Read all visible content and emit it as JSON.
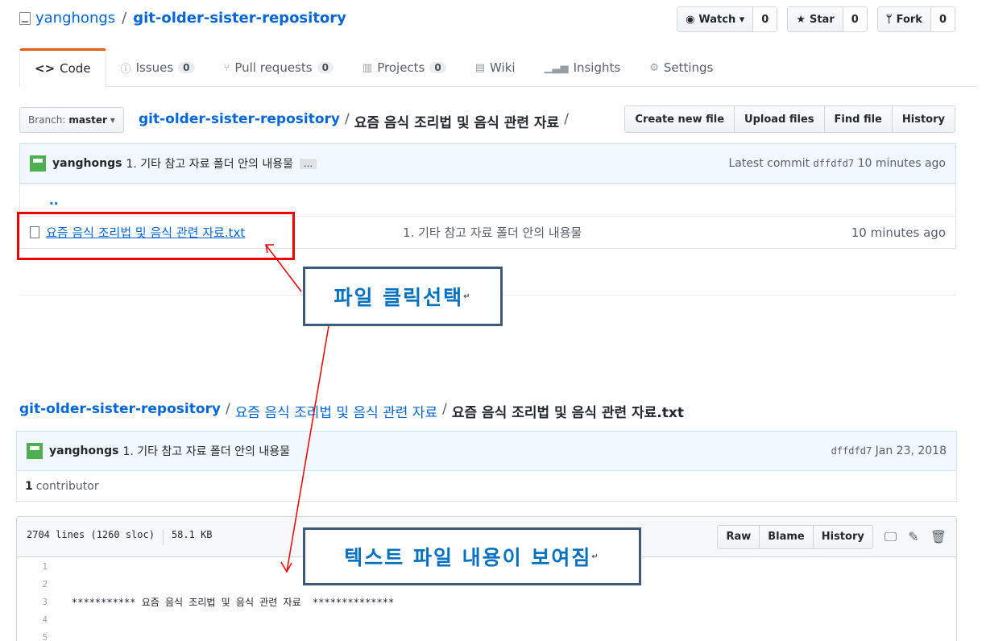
{
  "repo": {
    "owner": "yanghongs",
    "separator": "/",
    "name": "git-older-sister-repository"
  },
  "pagehead": {
    "watch_label": "Watch ▾",
    "watch_count": "0",
    "star_label": "Star",
    "star_count": "0",
    "fork_label": "Fork",
    "fork_count": "0"
  },
  "tabs": [
    {
      "label": "Code",
      "icon": "code-icon"
    },
    {
      "label": "Issues",
      "count": "0",
      "icon": "issue-icon"
    },
    {
      "label": "Pull requests",
      "count": "0",
      "icon": "pr-icon"
    },
    {
      "label": "Projects",
      "count": "0",
      "icon": "project-icon"
    },
    {
      "label": "Wiki",
      "icon": "wiki-icon"
    },
    {
      "label": "Insights",
      "icon": "graph-icon"
    },
    {
      "label": "Settings",
      "icon": "gear-icon"
    }
  ],
  "branch": {
    "prefix": "Branch:",
    "name": "master"
  },
  "breadcrumb_top": {
    "root": "git-older-sister-repository",
    "folder": "요즘 음식 조리법 및 음식 관련 자료"
  },
  "file_nav": [
    "Create new file",
    "Upload files",
    "Find file",
    "History"
  ],
  "latest_commit": {
    "author": "yanghongs",
    "message": "1. 기타 참고 자료 폴더 안의 내용물",
    "ellipsis": "…",
    "prefix": "Latest commit",
    "sha": "dffdfd7",
    "age": "10 minutes ago"
  },
  "files": {
    "parent": "..",
    "items": [
      {
        "name": "요즘 음식 조리법 및 음식 관련 자료.txt",
        "message": "1. 기타 참고 자료 폴더 안의 내용물",
        "age": "10 minutes ago"
      }
    ]
  },
  "callouts": {
    "first": "파일 클릭선택",
    "second": "텍스트 파일 내용이 보여짐",
    "para_mark": "↵"
  },
  "breadcrumb_bottom": {
    "root": "git-older-sister-repository",
    "folder": "요즘 음식 조리법 및 음식 관련 자료",
    "file": "요즘 음식 조리법 및 음식 관련 자료.txt"
  },
  "file_commit": {
    "author": "yanghongs",
    "message": "1. 기타 참고 자료 폴더 안의 내용물",
    "sha": "dffdfd7",
    "date": "Jan 23, 2018"
  },
  "contributors": {
    "count": "1",
    "label": "contributor"
  },
  "file_info": {
    "lines": "2704 lines (1260 sloc)",
    "size": "58.1 KB"
  },
  "file_actions": [
    "Raw",
    "Blame",
    "History"
  ],
  "code_lines": [
    {
      "n": "1",
      "text": ""
    },
    {
      "n": "2",
      "text": ""
    },
    {
      "n": "3",
      "text": "*********** 요즘 음식 조리법 및 음식 관련 자료  **************"
    },
    {
      "n": "4",
      "text": ""
    },
    {
      "n": "5",
      "text": ""
    }
  ],
  "colors": {
    "link": "#0366d6",
    "highlight_box": "#ee0000",
    "callout_text": "#0070c0",
    "callout_border": "#3d5a7a",
    "arrow": "#ee0000"
  }
}
